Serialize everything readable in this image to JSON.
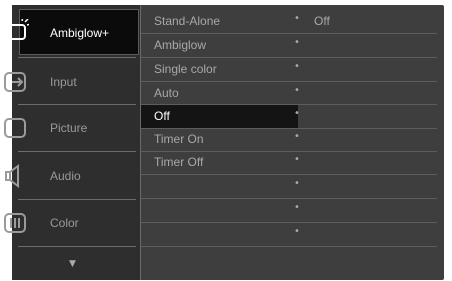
{
  "sidebar": {
    "items": [
      {
        "label": "Ambiglow+",
        "icon": "ambiglow-icon"
      },
      {
        "label": "Input",
        "icon": "input-icon"
      },
      {
        "label": "Picture",
        "icon": "picture-icon"
      },
      {
        "label": "Audio",
        "icon": "audio-icon"
      },
      {
        "label": "Color",
        "icon": "color-icon"
      }
    ],
    "more_glyph": "▼"
  },
  "submenu": {
    "rows": [
      {
        "label": "Stand-Alone",
        "dot": "•",
        "value": "Off"
      },
      {
        "label": "Ambiglow",
        "dot": "•",
        "value": ""
      },
      {
        "label": "Single color",
        "dot": "•",
        "value": ""
      },
      {
        "label": "Auto",
        "dot": "•",
        "value": ""
      },
      {
        "label": "Off",
        "dot": "•",
        "value": ""
      },
      {
        "label": "Timer On",
        "dot": "•",
        "value": ""
      },
      {
        "label": "Timer Off",
        "dot": "•",
        "value": ""
      },
      {
        "label": "",
        "dot": "•",
        "value": ""
      },
      {
        "label": "",
        "dot": "•",
        "value": ""
      },
      {
        "label": "",
        "dot": "•",
        "value": ""
      }
    ]
  },
  "colors": {
    "panel": "#3e3e3e",
    "sidebar": "#2e2e2e",
    "selected": "#0b0b0b",
    "text": "#a8a8a8",
    "text_active": "#ffffff"
  }
}
